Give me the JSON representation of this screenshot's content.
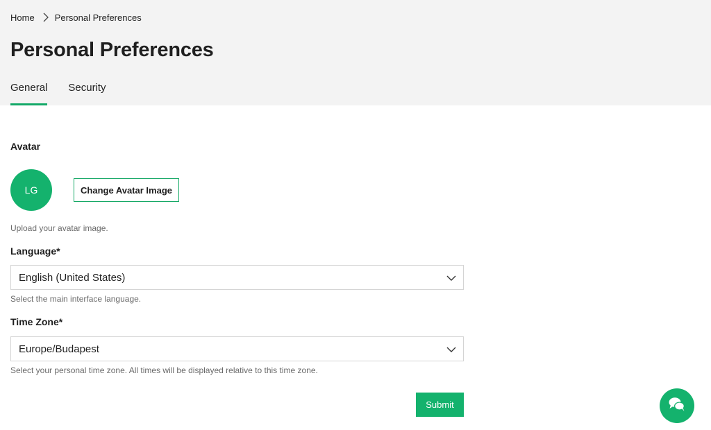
{
  "breadcrumb": {
    "home": "Home",
    "current": "Personal Preferences"
  },
  "page": {
    "title": "Personal Preferences"
  },
  "tabs": [
    {
      "label": "General",
      "active": true
    },
    {
      "label": "Security",
      "active": false
    }
  ],
  "avatar": {
    "label": "Avatar",
    "initials": "LG",
    "change_button": "Change Avatar Image",
    "helper": "Upload your avatar image."
  },
  "language": {
    "label": "Language*",
    "value": "English (United States)",
    "helper": "Select the main interface language."
  },
  "timezone": {
    "label": "Time Zone*",
    "value": "Europe/Budapest",
    "helper": "Select your personal time zone. All times will be displayed relative to this time zone."
  },
  "actions": {
    "submit": "Submit"
  },
  "colors": {
    "accent": "#14b26d",
    "header_bg": "#f3f3f3"
  },
  "icons": {
    "breadcrumb_separator": "chevron-right-icon",
    "select_arrow": "chevron-down-icon",
    "chat": "chat-bubbles-icon"
  }
}
